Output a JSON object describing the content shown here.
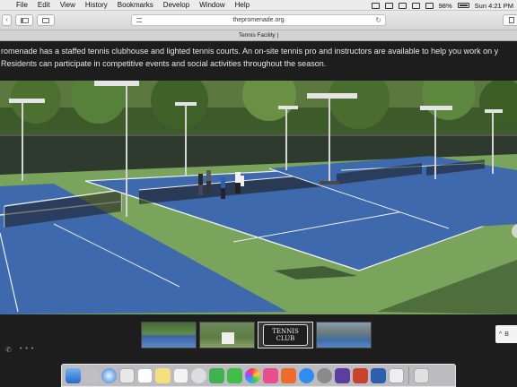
{
  "menubar": {
    "apple_glyph": "",
    "items": [
      "File",
      "Edit",
      "View",
      "History",
      "Bookmarks",
      "Develop",
      "Window",
      "Help"
    ],
    "battery": "98%",
    "clock": "Sun 4:21 PM"
  },
  "toolbar": {
    "back_glyph": "‹",
    "forward_glyph": "›",
    "url": "thepromenade.org",
    "reload_glyph": "↻"
  },
  "tab": {
    "title": "Tennis Facility |"
  },
  "page": {
    "description_line1": "romenade has a staffed tennis clubhouse and lighted tennis courts. An on-site tennis pro and instructors are available to help you work on y",
    "description_line2": "Residents can participate in competitive events and social activities throughout the season."
  },
  "gallery": {
    "thumbnails": [
      "courts",
      "lawn sign",
      "TENNIS CLUB",
      "clubhouse courts"
    ],
    "sign_line1": "TENNIS",
    "sign_line2": "CLUB",
    "back_label": "B",
    "back_glyph": "^"
  },
  "status": {
    "phone_glyph": "✆",
    "dots": "• • •"
  },
  "colors": {
    "court_blue": "#3f69ad",
    "court_green": "#7aa35c",
    "page_bg": "#1d1d1d",
    "menubar_bg": "#ececec"
  }
}
